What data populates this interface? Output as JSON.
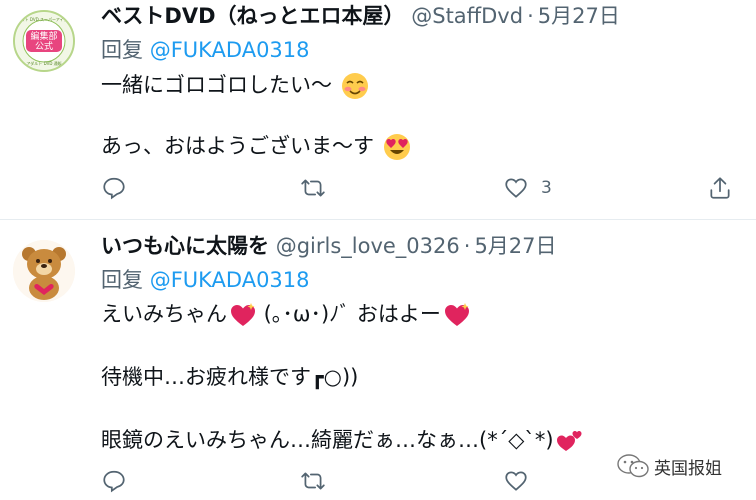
{
  "tweets": [
    {
      "name": "ベストDVD（ねっとエロ本屋）",
      "handle": "@StaffDvd",
      "separator": "·",
      "date": "5月27日",
      "reply_prefix": "回复",
      "reply_to": "@FUKADA0318",
      "avatar_text_top": "編集部",
      "avatar_text_bottom": "公式",
      "avatar_ring_top": "ベスト DVD スーパーアイテム",
      "avatar_ring_bottom": "アダルト DVD 通販",
      "lines": [
        "一緒にゴロゴロしたい〜",
        "",
        "あっ、おはようございま〜す"
      ],
      "retweet_count": "",
      "like_count": "3"
    },
    {
      "name": "いつも心に太陽を",
      "handle": "@girls_love_0326",
      "separator": "·",
      "date": "5月27日",
      "reply_prefix": "回复",
      "reply_to": "@FUKADA0318",
      "lines_a": "えいみちゃん",
      "lines_b": " (｡･ω･)ﾉﾞ おはよー",
      "line2": "待機中…お疲れ様です",
      "line2_tail": "┏○))",
      "line3": "眼鏡のえいみちゃん…綺麗だぁ…なぁ…(*´◇`*)",
      "like_count": ""
    }
  ],
  "watermark": "英国报姐",
  "colors": {
    "text": "#0f1419",
    "secondary": "#536471",
    "link": "#1d9bf0",
    "divider": "#e6ecf0"
  },
  "icons": [
    "reply-icon",
    "retweet-icon",
    "like-icon",
    "share-icon",
    "wechat-icon"
  ]
}
